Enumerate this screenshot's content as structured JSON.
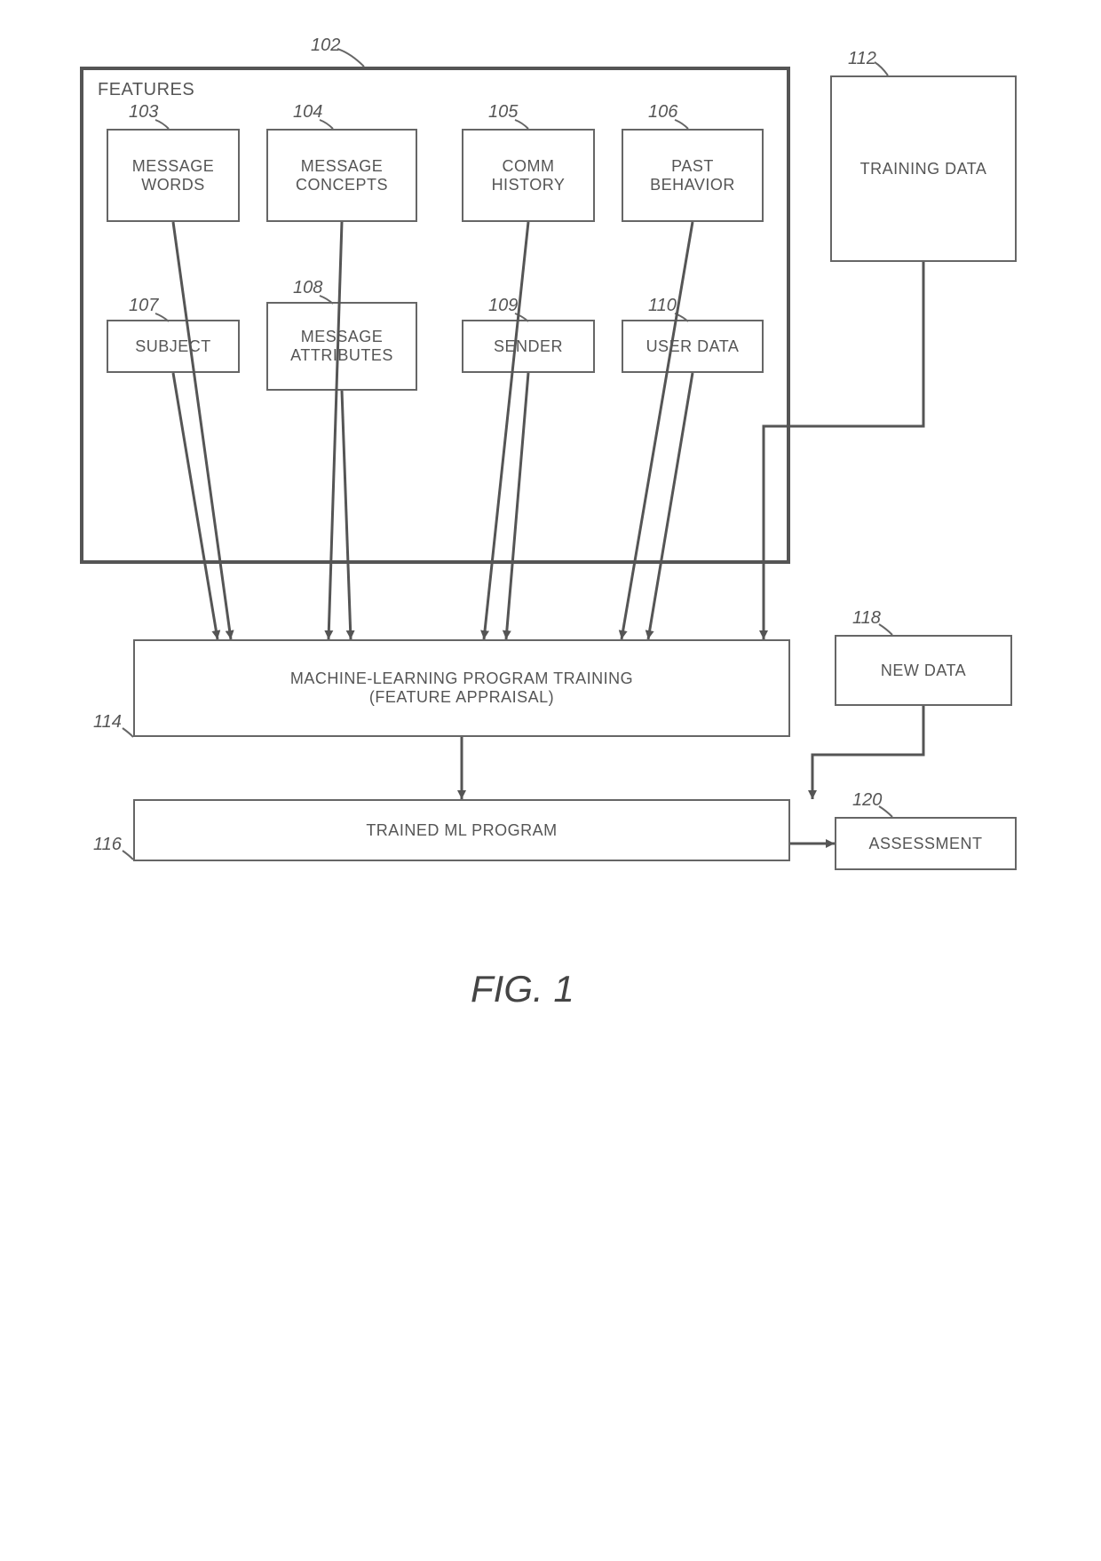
{
  "refs": {
    "features": "102",
    "message_words": "103",
    "message_concepts": "104",
    "comm_history": "105",
    "past_behavior": "106",
    "subject": "107",
    "message_attributes": "108",
    "sender": "109",
    "user_data": "110",
    "training_data": "112",
    "ml_training": "114",
    "trained_ml": "116",
    "new_data": "118",
    "assessment": "120"
  },
  "labels": {
    "features_title": "FEATURES",
    "message_words": "MESSAGE WORDS",
    "message_concepts": "MESSAGE CONCEPTS",
    "comm_history": "COMM HISTORY",
    "past_behavior": "PAST BEHAVIOR",
    "subject": "SUBJECT",
    "message_attributes": "MESSAGE ATTRIBUTES",
    "sender": "SENDER",
    "user_data": "USER DATA",
    "training_data": "TRAINING DATA",
    "ml_training_l1": "MACHINE-LEARNING PROGRAM TRAINING",
    "ml_training_l2": "(FEATURE APPRAISAL)",
    "trained_ml": "TRAINED ML PROGRAM",
    "new_data": "NEW DATA",
    "assessment": "ASSESSMENT",
    "figure": "FIG. 1"
  }
}
